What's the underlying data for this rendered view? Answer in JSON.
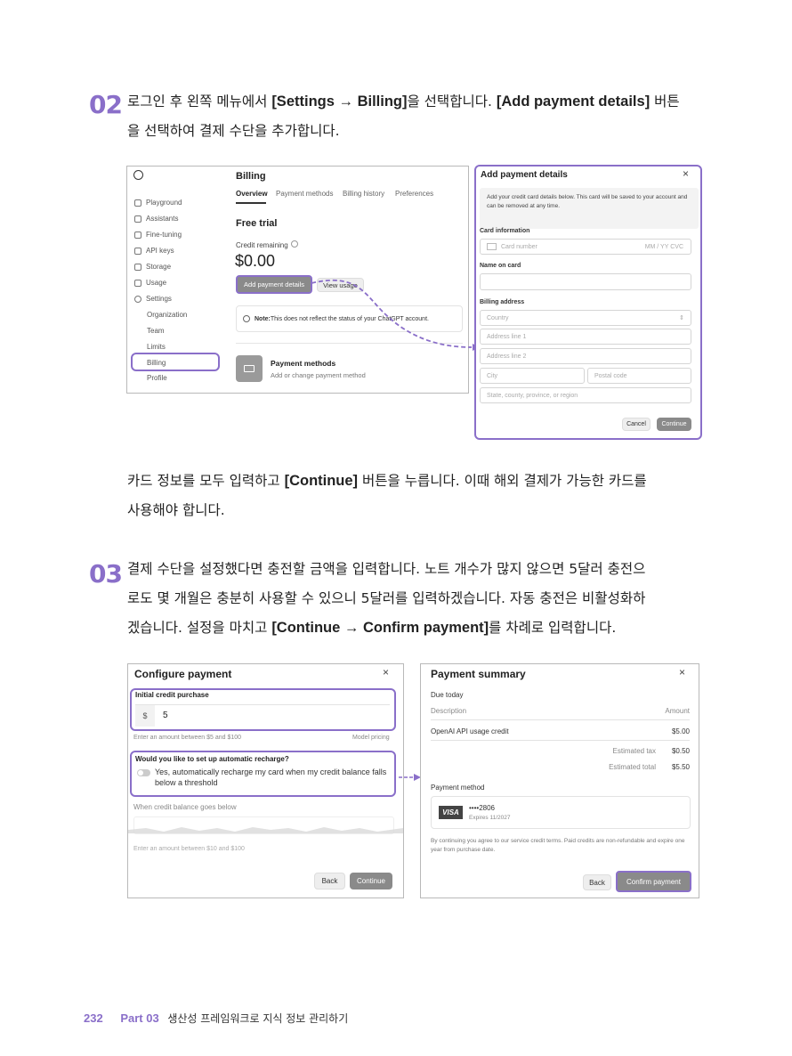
{
  "step2": {
    "number": "02",
    "line1_pre": "로그인 후 왼쪽 메뉴에서 ",
    "line1_b1": "[Settings → Billing]",
    "line1_mid": "을 선택합니다. ",
    "line1_b2": "[Add payment details]",
    "line1_post": " 버튼",
    "line2": "을 선택하여 결제 수단을 추가합니다."
  },
  "billing": {
    "sidebar": {
      "items": [
        "Playground",
        "Assistants",
        "Fine-tuning",
        "API keys",
        "Storage",
        "Usage",
        "Settings"
      ],
      "sub_items": [
        "Organization",
        "Team",
        "Limits",
        "Billing",
        "Profile"
      ]
    },
    "title": "Billing",
    "tabs": [
      "Overview",
      "Payment methods",
      "Billing history",
      "Preferences"
    ],
    "plan": "Free trial",
    "credit_label": "Credit remaining",
    "credit_value": "$0.00",
    "add_payment_button": "Add payment details",
    "view_usage_button": "View usage",
    "note_bold": "Note:",
    "note_text": " This does not reflect the status of your ChatGPT account.",
    "pm_title": "Payment methods",
    "pm_sub": "Add or change payment method"
  },
  "add_payment": {
    "title": "Add payment details",
    "close": "×",
    "info": "Add your credit card details below. This card will be saved to your account and can be removed at any time.",
    "card_info_label": "Card information",
    "card_number_placeholder": "Card number",
    "card_exp_cvc": "MM / YY  CVC",
    "name_label": "Name on card",
    "billing_label": "Billing address",
    "country": "Country",
    "address1": "Address line 1",
    "address2": "Address line 2",
    "city": "City",
    "postal": "Postal code",
    "state": "State, county, province, or region",
    "cancel": "Cancel",
    "continue": "Continue"
  },
  "mid_text": {
    "line1_pre": "카드 정보를 모두 입력하고 ",
    "line1_b": "[Continue]",
    "line1_post": " 버튼을 누릅니다. 이때 해외 결제가 가능한 카드를",
    "line2": "사용해야 합니다."
  },
  "step3": {
    "number": "03",
    "line1": "결제 수단을 설정했다면 충전할 금액을 입력합니다. 노트 개수가 많지 않으면 5달러 충전으",
    "line2": "로도 몇 개월은 충분히 사용할 수 있으니 5달러를 입력하겠습니다. 자동 충전은 비활성화하",
    "line3_pre": "겠습니다. 설정을 마치고 ",
    "line3_b": "[Continue → Confirm payment]",
    "line3_post": "를 차례로 입력합니다."
  },
  "configure": {
    "title": "Configure payment",
    "close": "×",
    "initial_label": "Initial credit purchase",
    "currency": "$",
    "amount": "5",
    "range_hint": "Enter an amount between $5 and $100",
    "model_pricing": "Model pricing",
    "recharge_q": "Would you like to set up automatic recharge?",
    "recharge_opt": "Yes, automatically recharge my card when my credit balance falls below a threshold",
    "balance_label": "When credit balance goes below",
    "balance_hint": "Enter an amount between $10 and $100",
    "back": "Back",
    "continue": "Continue"
  },
  "summary": {
    "title": "Payment summary",
    "close": "×",
    "due": "Due today",
    "col_desc": "Description",
    "col_amount": "Amount",
    "item": "OpenAI API usage credit",
    "item_amount": "$5.00",
    "tax_label": "Estimated tax",
    "tax": "$0.50",
    "total_label": "Estimated total",
    "total": "$5.50",
    "pm_label": "Payment method",
    "card_brand": "VISA",
    "card_num": "••••2806",
    "card_exp": "Expires 11/2027",
    "terms": "By continuing you agree to our service credit terms. Paid credits are non-refundable and expire one year from purchase date.",
    "back": "Back",
    "confirm": "Confirm payment"
  },
  "footer": {
    "page": "232",
    "part": "Part 03",
    "title": "생산성 프레임워크로 지식 정보 관리하기"
  },
  "colors": {
    "accent": "#8a6fc9",
    "button_grey": "#8a8a8a"
  }
}
